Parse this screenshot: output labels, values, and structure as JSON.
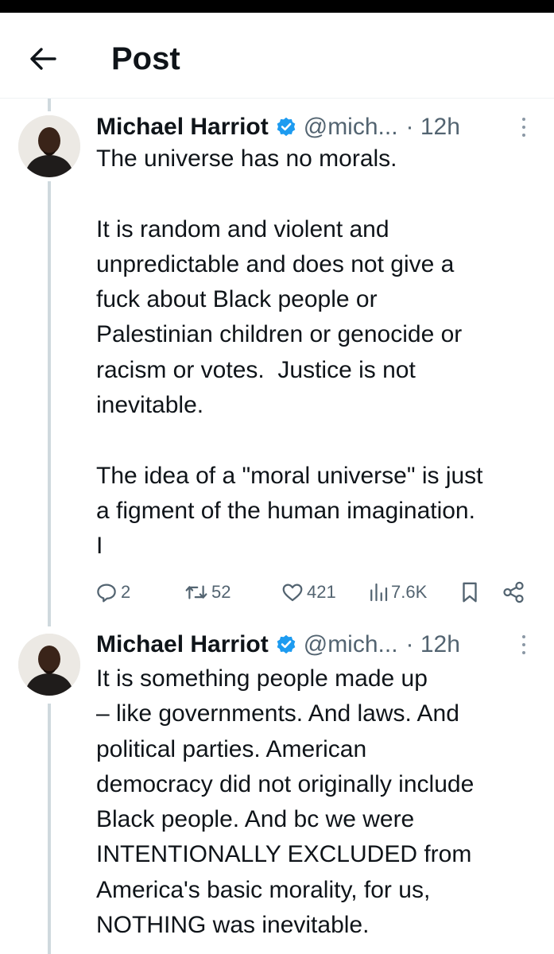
{
  "header": {
    "title": "Post"
  },
  "posts": [
    {
      "author": "Michael Harriot",
      "handle": "@mich...",
      "time": "· 12h",
      "text": "The universe has no morals.\n\nIt is random and violent and\nunpredictable and does not give a\nfuck about Black people or\nPalestinian children or genocide or\nracism or votes.  Justice is not\ninevitable.\n\nThe idea of a \"moral universe\" is just\na figment of the human imagination.\nI",
      "stats": {
        "replies": "2",
        "reposts": "52",
        "likes": "421",
        "views": "7.6K"
      }
    },
    {
      "author": "Michael Harriot",
      "handle": "@mich...",
      "time": "· 12h",
      "text": "It is something people made up\n– like governments. And laws. And\npolitical parties. American\ndemocracy did not originally include\nBlack people. And bc we were\nINTENTIONALLY EXCLUDED from\nAmerica's basic morality, for us,\nNOTHING was inevitable."
    }
  ],
  "colors": {
    "verified": "#1d9bf0",
    "thread_line": "#cfd9de",
    "secondary_text": "#536471"
  }
}
